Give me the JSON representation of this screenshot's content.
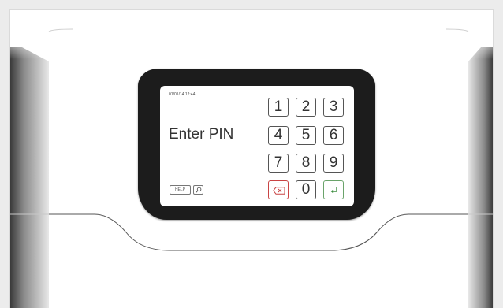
{
  "screen": {
    "datetime": "01/01/14 12:44",
    "prompt": "Enter PIN",
    "help_label": "HELP"
  },
  "keypad": {
    "keys": [
      "1",
      "2",
      "3",
      "4",
      "5",
      "6",
      "7",
      "8",
      "9",
      "0"
    ]
  },
  "icons": {
    "delete": "backspace-x-icon",
    "enter": "enter-return-icon",
    "search": "magnifier-icon"
  },
  "colors": {
    "bezel": "#1c1c1c",
    "delete_accent": "#c94444",
    "enter_accent": "#3e8e41",
    "housing": "#ffffff",
    "background": "#ececec"
  }
}
